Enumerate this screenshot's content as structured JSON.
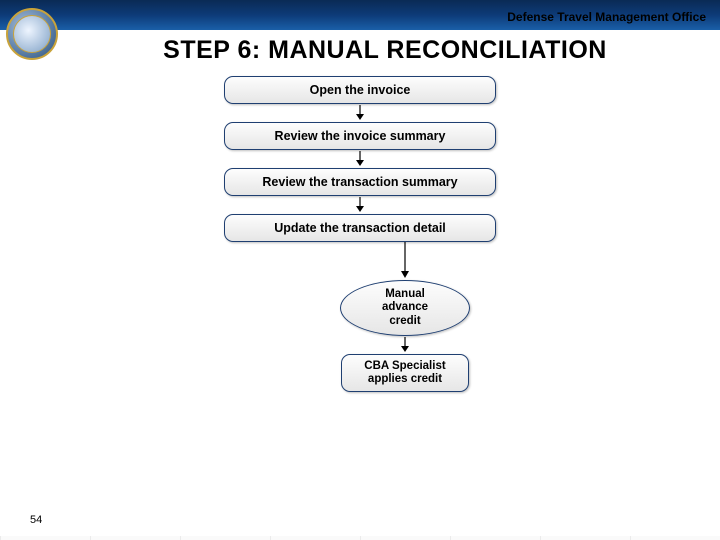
{
  "header": {
    "org": "Defense Travel Management Office"
  },
  "title": "STEP 6: MANUAL RECONCILIATION",
  "flow": {
    "steps": [
      "Open the invoice",
      "Review the invoice summary",
      "Review the transaction summary",
      "Update the transaction detail"
    ],
    "oval": "Manual\nadvance\ncredit",
    "final": "CBA Specialist\napplies credit"
  },
  "page_number": "54"
}
